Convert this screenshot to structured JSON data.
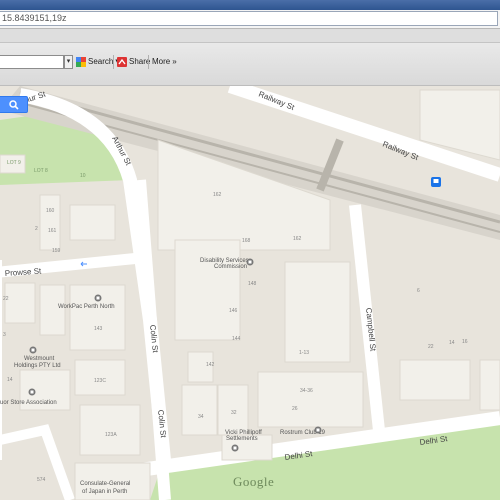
{
  "browser": {
    "url": "15.8439151,19z"
  },
  "toolbar": {
    "search_label": "Search",
    "share_label": "Share",
    "more_label": "More",
    "more_glyph": "»",
    "dropdown_glyph": "▾"
  },
  "map": {
    "streets": {
      "arthur_1": "Arthur St",
      "arthur_2": "Arthur St",
      "railway_1": "Railway St",
      "railway_2": "Railway St",
      "prowse": "Prowse St",
      "colin_1": "Colin St",
      "colin_2": "Colin St",
      "campbell": "Campbell St",
      "delhi_1": "Delhi St",
      "delhi_2": "Delhi St"
    },
    "places": {
      "disability_1": "Disability Services",
      "disability_2": "Commission",
      "workpac": "WorkPac Perth North",
      "westmount_1": "Westmount",
      "westmount_2": "Holdings PTY Ltd",
      "store_assoc": "uor Store Association",
      "vicki_1": "Vicki Phillipoff",
      "vicki_2": "Settlements",
      "rostrum": "Rostrum Club 19",
      "consulate_1": "Consulate-General",
      "consulate_2": "of Japan in Perth"
    },
    "lots": {
      "l162a": "162",
      "l162b": "162",
      "l168": "168",
      "l148": "148",
      "l146": "146",
      "l144": "144",
      "l142": "142",
      "l113": "1-13",
      "l3436": "34-36",
      "l26": "26",
      "l34": "34",
      "l32": "32",
      "l143": "143",
      "l123c": "123C",
      "l123a": "123A",
      "l22": "22",
      "l3": "3",
      "l14a": "14",
      "l161": "161",
      "l160": "160",
      "l2": "2",
      "l159": "159",
      "l6": "6",
      "l22b": "22",
      "l16": "16",
      "l14b": "14",
      "lot9": "LOT 9",
      "lot8": "LOT 8",
      "l10": "10",
      "l574": "574"
    },
    "logo": "Google"
  },
  "colors": {
    "road": "#ffffff",
    "land": "#e8e4dc",
    "building": "#f2f0ea",
    "park": "#c7e3ad",
    "rail": "#b8b4ab",
    "accent_blue": "#4d90fe"
  }
}
